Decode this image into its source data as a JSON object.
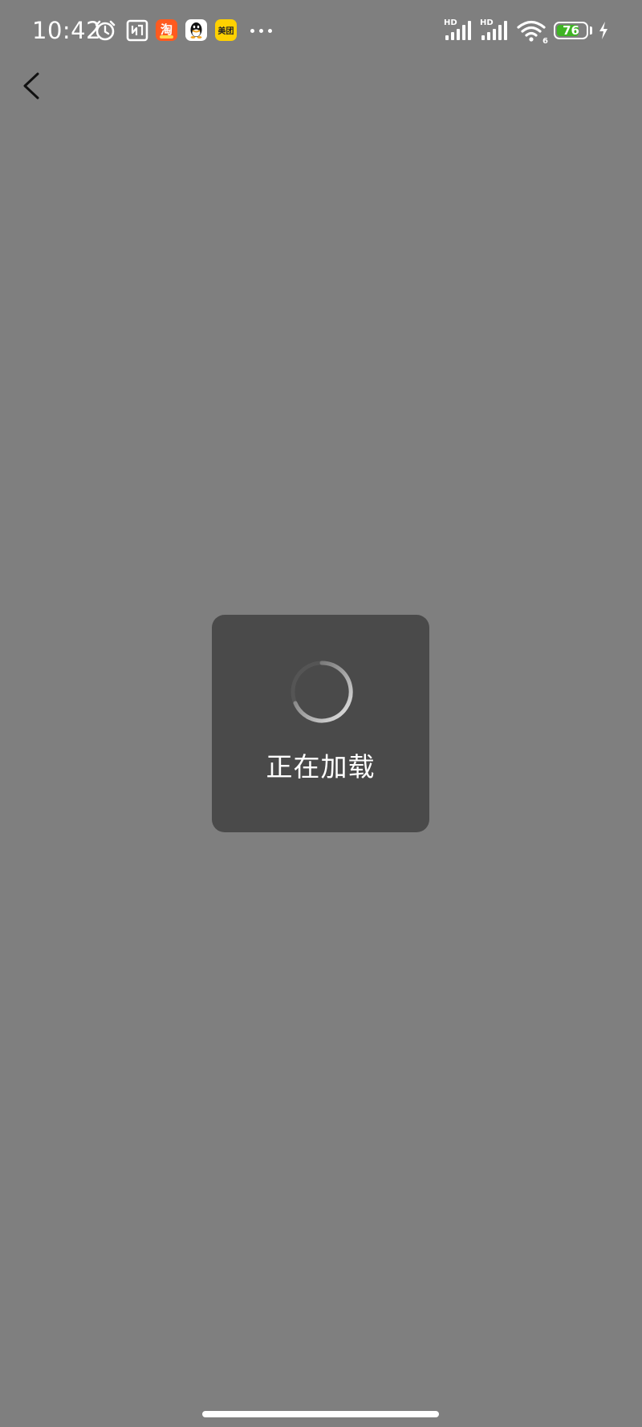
{
  "status_bar": {
    "time": "10:42",
    "alarm_icon": "alarm-clock-icon",
    "nfc_icon": "nfc-icon",
    "notification_apps": [
      {
        "name": "taobao-app-icon",
        "glyph": "淘",
        "color": "#ff5a1f"
      },
      {
        "name": "qq-app-icon",
        "glyph": "",
        "color": "#ffffff"
      },
      {
        "name": "meituan-app-icon",
        "glyph": "美团",
        "color": "#ffd100"
      }
    ],
    "more_icon": "more-notifications-icon",
    "signal_1_label": "HD",
    "signal_2_label": "HD",
    "wifi_label": "6",
    "battery_level": "76",
    "battery_fraction": 0.76,
    "battery_color": "#3fb424",
    "charging_icon": "charging-bolt-icon"
  },
  "navigation": {
    "back_icon": "back-arrow-icon"
  },
  "loading": {
    "text": "正在加载",
    "spinner_icon": "loading-spinner-icon"
  },
  "colors": {
    "background": "#7f7f7f",
    "dialog": "#4a4a4a"
  }
}
